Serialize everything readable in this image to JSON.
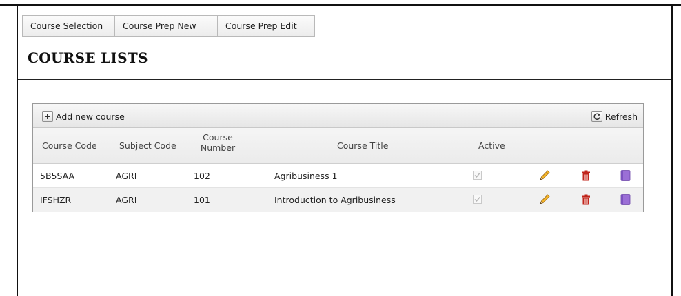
{
  "tabs": [
    {
      "label": "Course Selection"
    },
    {
      "label": "Course Prep New"
    },
    {
      "label": "Course Prep Edit"
    }
  ],
  "page_title": "COURSE LISTS",
  "toolbar": {
    "add_label": "Add new course",
    "refresh_label": "Refresh"
  },
  "columns": {
    "course_code": "Course Code",
    "subject_code": "Subject Code",
    "course_number_line1": "Course",
    "course_number_line2": "Number",
    "course_title": "Course Title",
    "active": "Active"
  },
  "rows": [
    {
      "course_code": "5B5SAA",
      "subject_code": "AGRI",
      "course_number": "102",
      "course_title": "Agribusiness 1",
      "active": true
    },
    {
      "course_code": "IFSHZR",
      "subject_code": "AGRI",
      "course_number": "101",
      "course_title": "Introduction to Agribusiness",
      "active": true
    }
  ],
  "icons": {
    "add": "plus-icon",
    "refresh": "refresh-icon",
    "edit": "pencil-icon",
    "delete": "trash-icon",
    "details": "book-icon"
  },
  "colors": {
    "edit_icon": "#e6a11c",
    "delete_icon": "#c0241b",
    "details_icon": "#9b6fd6"
  }
}
